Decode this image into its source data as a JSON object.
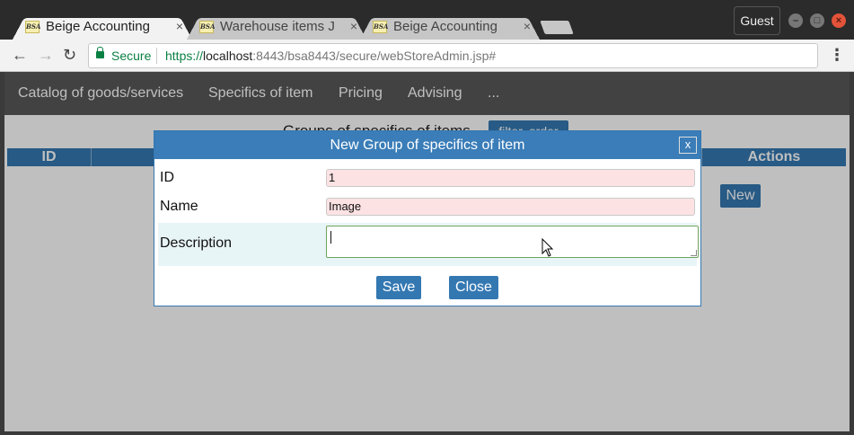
{
  "browser": {
    "tabs": [
      {
        "favicon": "BSA",
        "title": "Beige Accounting",
        "close": "×",
        "active": true
      },
      {
        "favicon": "BSA",
        "title": "Warehouse items J",
        "close": "×",
        "active": false
      },
      {
        "favicon": "BSA",
        "title": "Beige Accounting",
        "close": "×",
        "active": false
      }
    ],
    "profile": "Guest",
    "secure_label": "Secure",
    "url": {
      "scheme": "https://",
      "host": "localhost",
      "rest": ":8443/bsa8443/secure/webStoreAdmin.jsp#"
    },
    "icons": {
      "back": "←",
      "forward": "→",
      "reload": "↻",
      "menu": "⋮"
    }
  },
  "app": {
    "nav": [
      "Catalog of goods/services",
      "Specifics of item",
      "Pricing",
      "Advising",
      "..."
    ],
    "heading": "Groups of specifics of items",
    "filter_button": "filter, order",
    "table_headers": {
      "id": "ID",
      "actions": "Actions"
    },
    "new_button": "New"
  },
  "dialog": {
    "title": "New Group of specifics of item",
    "close_label": "x",
    "fields": {
      "id": {
        "label": "ID",
        "value": "1"
      },
      "name": {
        "label": "Name",
        "value": "Image"
      },
      "description": {
        "label": "Description",
        "value": ""
      }
    },
    "save_label": "Save",
    "close_button": "Close"
  },
  "colors": {
    "accent": "#3478b2",
    "nav_bg": "#595959",
    "required_bg": "#fde2e4",
    "alt_row": "#e8f5f7"
  }
}
